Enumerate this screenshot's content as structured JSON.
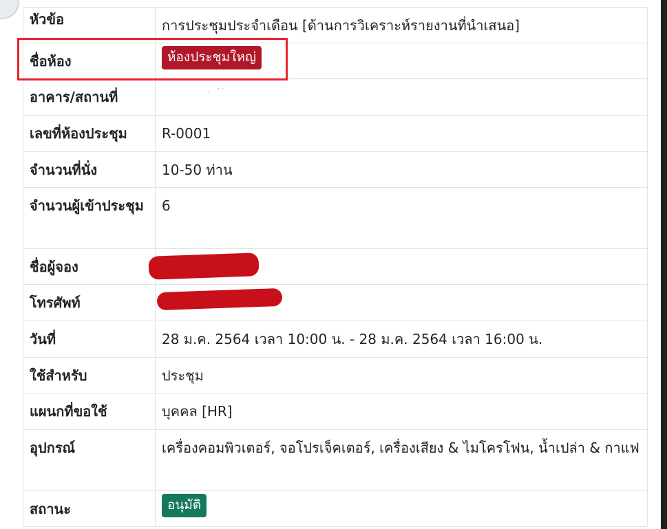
{
  "rows": [
    {
      "label": "หัวข้อ",
      "value": "การประชุมประจำเดือน [ด้านการวิเคราะห์รายงานที่นำเสนอ]"
    },
    {
      "label": "ชื่อห้อง",
      "value": "ห้องประชุมใหญ่"
    },
    {
      "label": "อาคาร/สถานที่",
      "value": ""
    },
    {
      "label": "เลขที่ห้องประชุม",
      "value": "R-0001"
    },
    {
      "label": "จำนวนที่นั่ง",
      "value": "10-50 ท่าน"
    },
    {
      "label": "จำนวนผู้เข้าประชุม",
      "value": "6"
    },
    {
      "label": "ชื่อผู้จอง",
      "value": ""
    },
    {
      "label": "โทรศัพท์",
      "value": ""
    },
    {
      "label": "วันที่",
      "value": "28 ม.ค. 2564 เวลา 10:00 น. - 28 ม.ค. 2564 เวลา 16:00 น."
    },
    {
      "label": "ใช้สำหรับ",
      "value": "ประชุม"
    },
    {
      "label": "แผนกที่ขอใช้",
      "value": "บุคคล [HR]"
    },
    {
      "label": "อุปกรณ์",
      "value": "เครื่องคอมพิวเตอร์, จอโปรเจ็คเตอร์, เครื่องเสียง & ไมโครโฟน, น้ำเปล่า & กาแฟ"
    },
    {
      "label": "สถานะ",
      "value": "อนุมัติ"
    }
  ],
  "colors": {
    "room_badge": "#b0182a",
    "status_badge": "#15795b",
    "highlight_border": "#e8222a",
    "redaction": "#c8101a"
  }
}
